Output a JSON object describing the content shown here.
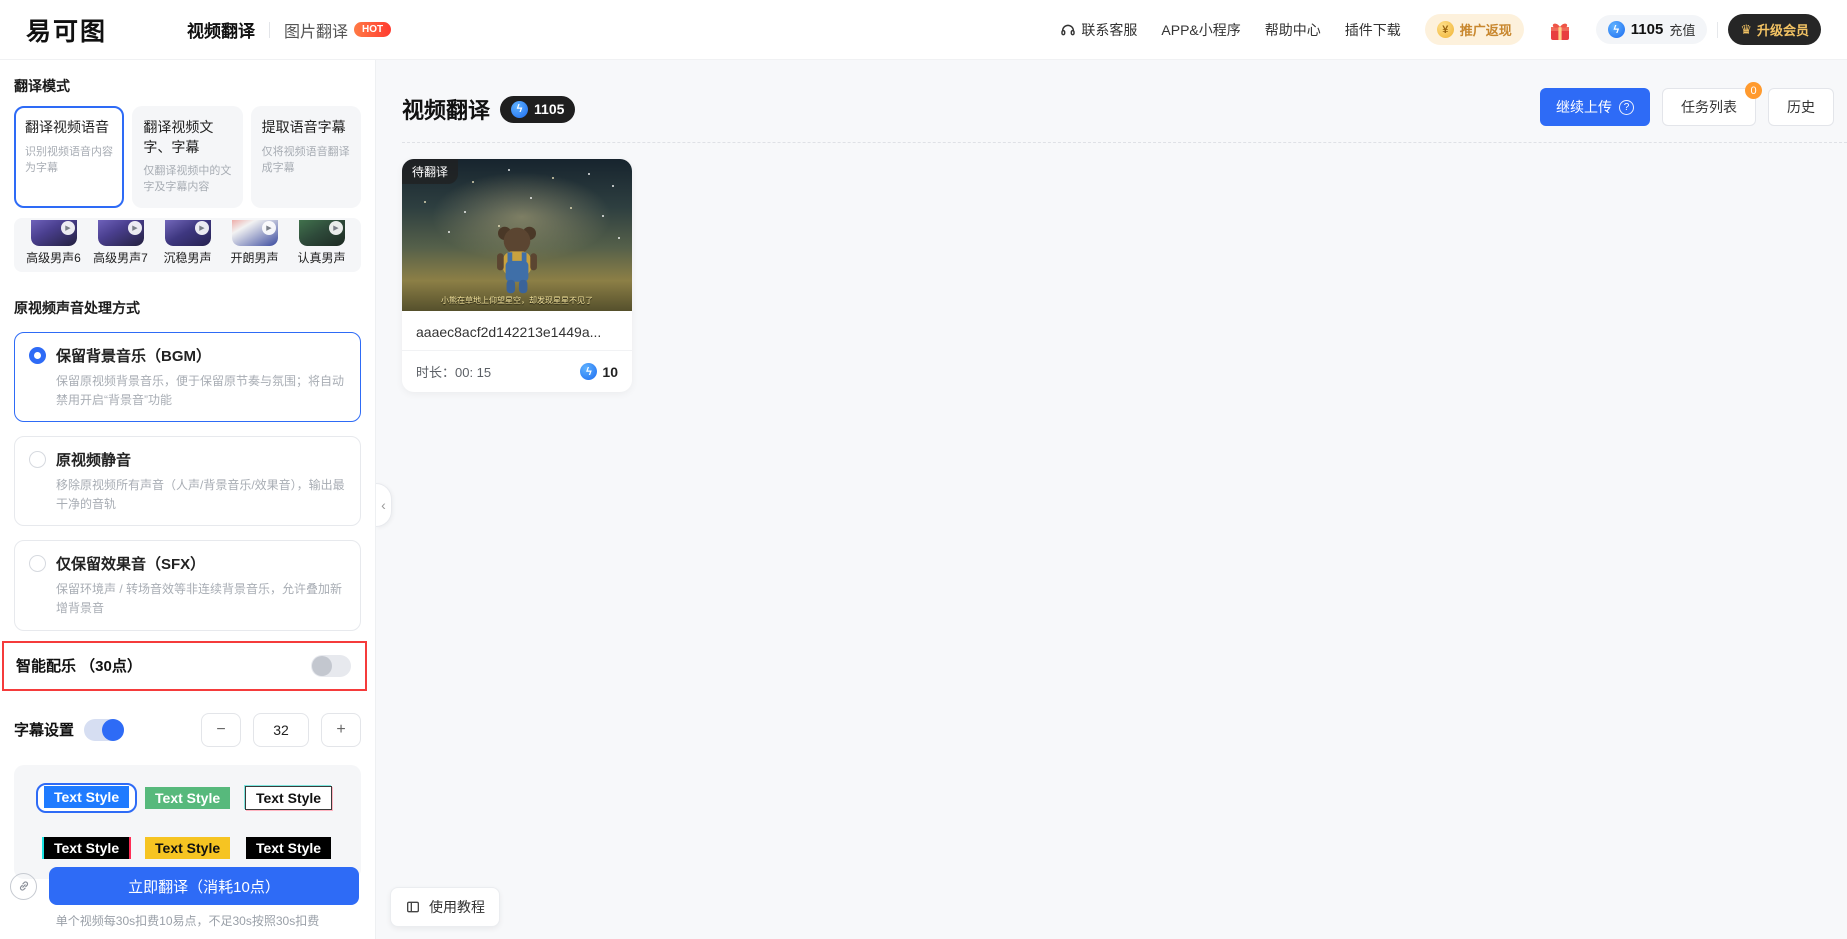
{
  "navbar": {
    "logo": "易可图",
    "tabs": [
      {
        "label": "视频翻译"
      },
      {
        "label": "图片翻译",
        "badge": "HOT"
      }
    ],
    "links": [
      {
        "label": "联系客服"
      },
      {
        "label": "APP&小程序"
      },
      {
        "label": "帮助中心"
      },
      {
        "label": "插件下载"
      }
    ],
    "promo_label": "推广返现",
    "balance": "1105",
    "recharge_label": "充值",
    "upgrade_label": "升级会员"
  },
  "sidebar": {
    "mode_title": "翻译模式",
    "mode_cards": [
      {
        "title": "翻译视频语音",
        "desc": "识别视频语音内容为字幕"
      },
      {
        "title": "翻译视频文字、字幕",
        "desc": "仅翻译视频中的文字及字幕内容"
      },
      {
        "title": "提取语音字幕",
        "desc": "仅将视频语音翻译成字幕"
      }
    ],
    "voices": [
      {
        "name": "高级男声6"
      },
      {
        "name": "高级男声7"
      },
      {
        "name": "沉稳男声"
      },
      {
        "name": "开朗男声"
      },
      {
        "name": "认真男声"
      }
    ],
    "audio_title": "原视频声音处理方式",
    "audio_options": [
      {
        "title": "保留背景音乐（BGM）",
        "desc": "保留原视频背景音乐，便于保留原节奏与氛围；将自动禁用开启“背景音”功能"
      },
      {
        "title": "原视频静音",
        "desc": "移除原视频所有声音（人声/背景音乐/效果音），输出最干净的音轨"
      },
      {
        "title": "仅保留效果音（SFX）",
        "desc": "保留环境声 / 转场音效等非连续背景音乐，允许叠加新增背景音"
      }
    ],
    "smart_music_label": "智能配乐 （30点）",
    "subtitle_label": "字幕设置",
    "font_size_value": "32",
    "minus_label": "−",
    "plus_label": "+",
    "text_styles": [
      {
        "label": "Text Style"
      },
      {
        "label": "Text Style"
      },
      {
        "label": "Text Style"
      },
      {
        "label": "Text Style"
      },
      {
        "label": "Text Style"
      },
      {
        "label": "Text Style"
      }
    ],
    "translate_label": "立即翻译（消耗10点）",
    "billing_note": "单个视频每30s扣费10易点，不足30s按照30s扣费"
  },
  "main": {
    "title": "视频翻译",
    "balance_badge": "1105",
    "upload_label": "继续上传",
    "tasks_label": "任务列表",
    "tasks_badge": "0",
    "history_label": "历史",
    "card": {
      "status": "待翻译",
      "caption": "小熊在草地上仰望星空，却发现星星不见了",
      "filename": "aaaec8acf2d142213e1449a...",
      "duration": "时长：00: 15",
      "cost": "10"
    },
    "tutorial_label": "使用教程"
  },
  "colors": {
    "primary_blue": "#2e6bf6",
    "hot_red": "#ff3b30",
    "highlight_red": "#f53b3b",
    "dark_badge": "#1f1f1f",
    "orange_badge": "#ff9a2e",
    "gold": "#f4c464",
    "panel_gray": "#f5f6f8",
    "main_bg": "#f7f8fa"
  }
}
